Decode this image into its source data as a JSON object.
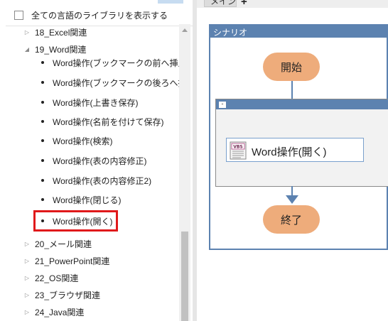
{
  "library": {
    "show_all_label": "全ての言語のライブラリを表示する",
    "items": [
      {
        "label": "18_Excel関連",
        "kind": "folder",
        "expanded": false
      },
      {
        "label": "19_Word関連",
        "kind": "folder",
        "expanded": true
      },
      {
        "label": "Word操作(ブックマークの前へ挿入)",
        "kind": "action"
      },
      {
        "label": "Word操作(ブックマークの後ろへ挿入)",
        "kind": "action"
      },
      {
        "label": "Word操作(上書き保存)",
        "kind": "action"
      },
      {
        "label": "Word操作(名前を付けて保存)",
        "kind": "action"
      },
      {
        "label": "Word操作(検索)",
        "kind": "action"
      },
      {
        "label": "Word操作(表の内容修正)",
        "kind": "action"
      },
      {
        "label": "Word操作(表の内容修正2)",
        "kind": "action"
      },
      {
        "label": "Word操作(閉じる)",
        "kind": "action"
      },
      {
        "label": "Word操作(開く)",
        "kind": "action",
        "selected": true
      },
      {
        "label": "20_メール関連",
        "kind": "folder",
        "expanded": false
      },
      {
        "label": "21_PowerPoint関連",
        "kind": "folder",
        "expanded": false
      },
      {
        "label": "22_OS関連",
        "kind": "folder",
        "expanded": false
      },
      {
        "label": "23_ブラウザ関連",
        "kind": "folder",
        "expanded": false
      },
      {
        "label": "24_Java関連",
        "kind": "folder",
        "expanded": false
      }
    ],
    "selection_color": "#e0191b"
  },
  "designer": {
    "tab_main_label": "メイン",
    "tab_add_label": "+",
    "scenario_title": "シナリオ",
    "start_label": "開始",
    "end_label": "終了",
    "group_collapse_label": "-",
    "action_label": "Word操作(開く)",
    "action_icon_text": "VBS",
    "accent_color": "#5c82b0",
    "terminal_color": "#eeac7b"
  }
}
